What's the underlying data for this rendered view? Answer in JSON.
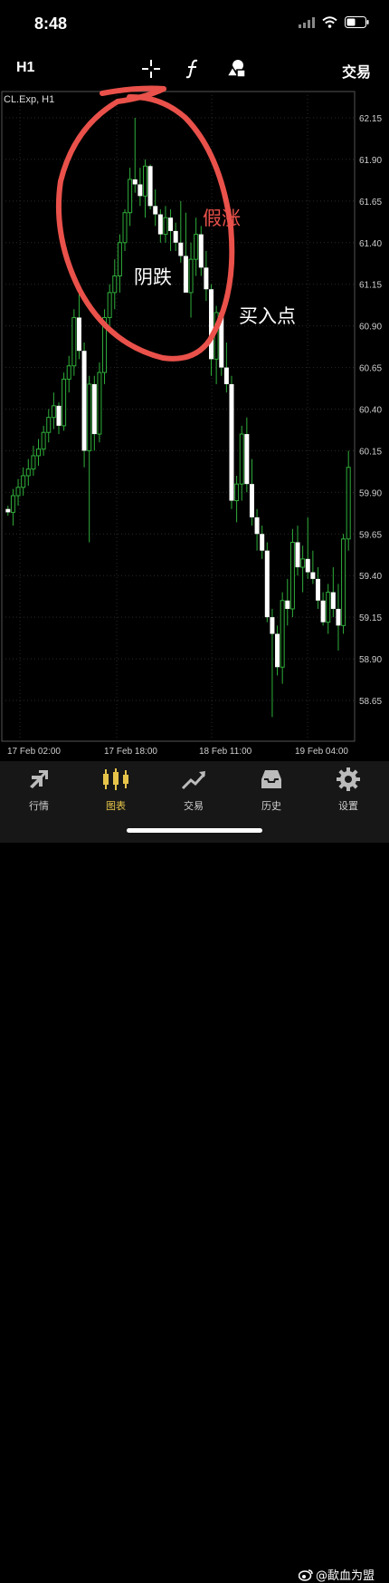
{
  "status_bar": {
    "time": "8:48"
  },
  "toolbar": {
    "period": "H1",
    "trade_label": "交易"
  },
  "chart_data": {
    "type": "candlestick",
    "symbol_label": "CL.Exp, H1",
    "y_ticks": [
      "62.15",
      "61.90",
      "61.65",
      "61.40",
      "61.15",
      "60.90",
      "60.65",
      "60.40",
      "60.15",
      "59.90",
      "59.65",
      "59.40",
      "59.15",
      "58.90",
      "58.65"
    ],
    "x_ticks": [
      "17 Feb 02:00",
      "17 Feb 18:00",
      "18 Feb 11:00",
      "19 Feb 04:00"
    ],
    "ylim": [
      58.45,
      62.3
    ],
    "candles": [
      [
        59.8,
        59.82,
        59.76,
        59.78
      ],
      [
        59.78,
        59.92,
        59.7,
        59.88
      ],
      [
        59.88,
        59.98,
        59.82,
        59.93
      ],
      [
        59.93,
        60.05,
        59.88,
        60.0
      ],
      [
        60.0,
        60.1,
        59.94,
        60.04
      ],
      [
        60.04,
        60.18,
        60.0,
        60.12
      ],
      [
        60.12,
        60.22,
        60.06,
        60.16
      ],
      [
        60.16,
        60.3,
        60.12,
        60.26
      ],
      [
        60.26,
        60.4,
        60.2,
        60.35
      ],
      [
        60.35,
        60.5,
        60.28,
        60.42
      ],
      [
        60.42,
        60.44,
        60.25,
        60.3
      ],
      [
        60.3,
        60.62,
        60.27,
        60.58
      ],
      [
        60.58,
        60.72,
        60.5,
        60.66
      ],
      [
        60.66,
        61.0,
        60.6,
        60.95
      ],
      [
        60.95,
        61.15,
        60.7,
        60.75
      ],
      [
        60.75,
        60.8,
        60.05,
        60.15
      ],
      [
        60.15,
        60.6,
        59.6,
        60.55
      ],
      [
        60.55,
        60.6,
        60.15,
        60.25
      ],
      [
        60.25,
        60.68,
        60.2,
        60.62
      ],
      [
        60.62,
        61.0,
        60.55,
        60.95
      ],
      [
        60.95,
        61.15,
        60.9,
        61.1
      ],
      [
        61.1,
        61.3,
        61.0,
        61.2
      ],
      [
        61.2,
        61.45,
        61.1,
        61.4
      ],
      [
        61.4,
        61.6,
        61.35,
        61.58
      ],
      [
        61.58,
        61.85,
        61.5,
        61.78
      ],
      [
        61.78,
        62.15,
        61.7,
        61.75
      ],
      [
        61.75,
        61.85,
        61.62,
        61.68
      ],
      [
        61.68,
        61.9,
        61.55,
        61.86
      ],
      [
        61.86,
        61.87,
        61.6,
        61.62
      ],
      [
        61.62,
        61.72,
        61.5,
        61.57
      ],
      [
        61.57,
        61.6,
        61.4,
        61.45
      ],
      [
        61.45,
        61.62,
        61.4,
        61.55
      ],
      [
        61.55,
        61.6,
        61.35,
        61.47
      ],
      [
        61.47,
        61.52,
        61.35,
        61.4
      ],
      [
        61.4,
        61.65,
        61.28,
        61.32
      ],
      [
        61.32,
        61.58,
        61.12,
        61.1
      ],
      [
        61.1,
        61.4,
        60.95,
        61.3
      ],
      [
        61.3,
        61.55,
        61.2,
        61.45
      ],
      [
        61.45,
        61.5,
        61.2,
        61.25
      ],
      [
        61.25,
        61.35,
        61.05,
        61.12
      ],
      [
        61.12,
        61.15,
        60.6,
        60.7
      ],
      [
        60.7,
        61.02,
        60.55,
        60.98
      ],
      [
        60.98,
        61.0,
        60.6,
        60.65
      ],
      [
        60.65,
        60.8,
        60.5,
        60.55
      ],
      [
        60.55,
        60.6,
        59.8,
        59.85
      ],
      [
        59.85,
        60.0,
        59.72,
        59.95
      ],
      [
        59.95,
        60.3,
        59.85,
        60.25
      ],
      [
        60.25,
        60.35,
        59.9,
        59.95
      ],
      [
        59.95,
        60.1,
        59.7,
        59.75
      ],
      [
        59.75,
        59.8,
        59.55,
        59.65
      ],
      [
        59.65,
        59.7,
        59.5,
        59.55
      ],
      [
        59.55,
        59.6,
        59.12,
        59.15
      ],
      [
        59.15,
        59.2,
        58.55,
        59.05
      ],
      [
        59.05,
        59.1,
        58.8,
        58.85
      ],
      [
        58.85,
        59.3,
        58.75,
        59.25
      ],
      [
        59.25,
        59.38,
        59.1,
        59.2
      ],
      [
        59.2,
        59.68,
        59.15,
        59.6
      ],
      [
        59.6,
        59.7,
        59.4,
        59.45
      ],
      [
        59.45,
        59.58,
        59.3,
        59.5
      ],
      [
        59.5,
        59.75,
        59.38,
        59.42
      ],
      [
        59.42,
        59.55,
        59.35,
        59.38
      ],
      [
        59.38,
        59.45,
        59.2,
        59.25
      ],
      [
        59.25,
        59.3,
        59.1,
        59.12
      ],
      [
        59.12,
        59.35,
        59.05,
        59.3
      ],
      [
        59.3,
        59.45,
        59.15,
        59.2
      ],
      [
        59.2,
        59.35,
        58.95,
        59.1
      ],
      [
        59.1,
        59.65,
        59.05,
        59.62
      ],
      [
        59.62,
        60.15,
        59.55,
        60.05
      ]
    ]
  },
  "annotations": {
    "fake_rise": "假涨",
    "bearish_drop": "阴跌",
    "entry_point": "买入点"
  },
  "tabs": [
    {
      "label": "行情",
      "icon": "quotes-icon"
    },
    {
      "label": "图表",
      "icon": "chart-icon"
    },
    {
      "label": "交易",
      "icon": "trade-icon"
    },
    {
      "label": "历史",
      "icon": "history-icon"
    },
    {
      "label": "设置",
      "icon": "settings-icon"
    }
  ],
  "watermark": {
    "text": "@歃血为盟"
  },
  "colors": {
    "background": "#000000",
    "bull": "#ffffff",
    "wick": "#2fae3a",
    "grid": "#2a2a2a",
    "annotation_red": "#e9514a",
    "active_tab": "#e6c44a"
  }
}
